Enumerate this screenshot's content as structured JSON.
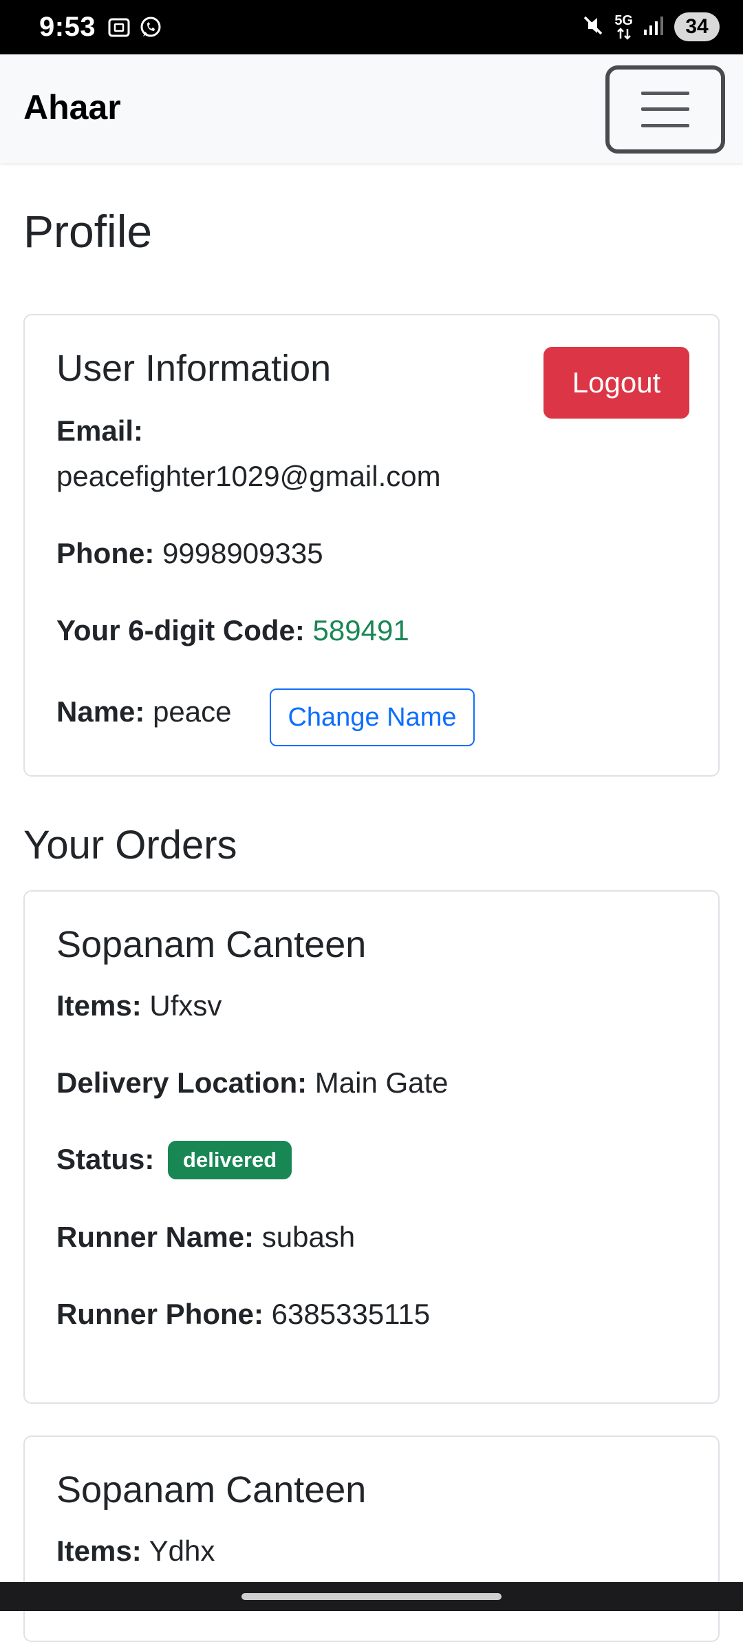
{
  "status_bar": {
    "time": "9:53",
    "network": "5G",
    "battery": "34",
    "left_icons": [
      "screenshot-icon",
      "whatsapp-icon"
    ],
    "right_icons": [
      "mute-icon",
      "5g-data-icon",
      "signal-icon",
      "battery-icon"
    ]
  },
  "navbar": {
    "brand": "Ahaar",
    "toggler_icon": "hamburger-menu-icon"
  },
  "page": {
    "title": "Profile"
  },
  "user_info": {
    "title": "User Information",
    "logout_label": "Logout",
    "email_label": "Email:",
    "email": "peacefighter1029@gmail.com",
    "phone_label": "Phone:",
    "phone": "9998909335",
    "code_label": "Your 6-digit Code:",
    "code": "589491",
    "name_label": "Name:",
    "name": "peace",
    "change_name_label": "Change Name"
  },
  "orders": {
    "title": "Your Orders",
    "items": [
      {
        "canteen": "Sopanam Canteen",
        "items_label": "Items:",
        "items": "Ufxsv",
        "location_label": "Delivery Location:",
        "location": "Main Gate",
        "status_label": "Status:",
        "status": "delivered",
        "runner_name_label": "Runner Name:",
        "runner_name": "subash",
        "runner_phone_label": "Runner Phone:",
        "runner_phone": "6385335115"
      },
      {
        "canteen": "Sopanam Canteen",
        "items_label": "Items:",
        "items": "Ydhx"
      }
    ]
  },
  "colors": {
    "danger": "#dc3545",
    "primary": "#0d6efd",
    "success": "#198754",
    "navbar_bg": "#f8f9fa"
  }
}
